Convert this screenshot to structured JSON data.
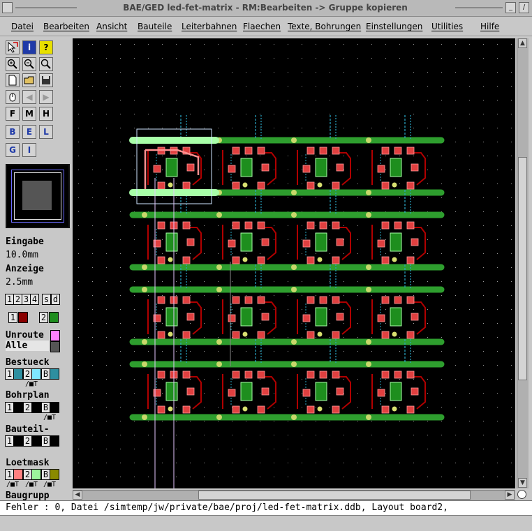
{
  "window": {
    "title": "BAE/GED led-fet-matrix - RM:Bearbeiten -> Gruppe kopieren",
    "buttons": [
      "_",
      "/",
      "|"
    ]
  },
  "menu": [
    "Datei",
    "Bearbeiten",
    "Ansicht",
    "Bauteile",
    "Leiterbahnen",
    "Flaechen",
    "Texte, Bohrungen",
    "Einstellungen",
    "Utilities",
    "Hilfe"
  ],
  "toolbar": {
    "row1": [
      "?",
      "i",
      "?"
    ],
    "layer_buttons": [
      "F",
      "M",
      "H",
      "B",
      "E",
      "L",
      "G",
      "I"
    ]
  },
  "panel": {
    "input_label": "Eingabe",
    "input_value": "10.0mm",
    "display_label": "Anzeige",
    "display_value": "2.5mm",
    "layer_nums": [
      "1",
      "2",
      "3",
      "4",
      "s",
      "d"
    ],
    "layer1": "1",
    "layer2": "2",
    "unroute": "Unroute",
    "alle": "Alle",
    "bestueck": "Bestueck",
    "bohrplan": "Bohrplan",
    "bauteil": "Bauteil-",
    "loetmask": "Loetmask",
    "baugrupp": "Baugrupp",
    "side_labels": [
      "1",
      "2",
      "B"
    ],
    "mark": "/■T"
  },
  "canvas": {
    "matrix_rows": 4,
    "matrix_cols": 4
  },
  "status": {
    "text": "Fehler : 0, Datei /simtemp/jw/private/bae/proj/led-fet-matrix.ddb, Layout board2,"
  },
  "colors": {
    "title_text": "#444444",
    "copper_green": "#2e9e2e",
    "pad_red": "#e04040",
    "trace_darkred": "#b00000",
    "label_cyan": "#2aa7c4",
    "highlight": "#a8ffa8"
  }
}
